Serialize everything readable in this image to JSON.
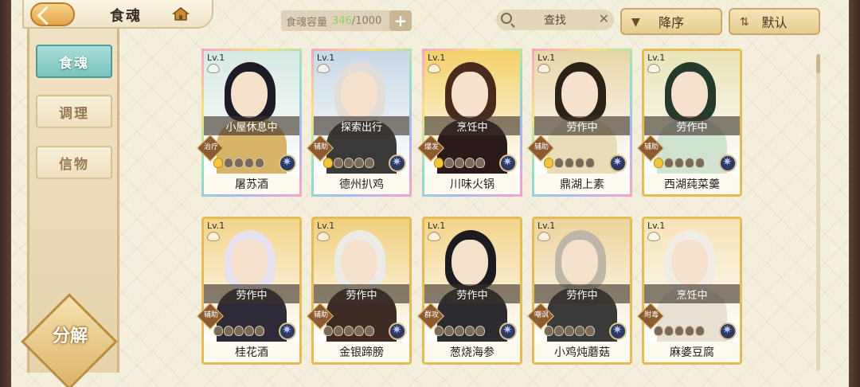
{
  "header": {
    "title": "食魂",
    "capacity_label": "食魂容量",
    "capacity_current": "346",
    "capacity_max": "/1000",
    "capacity_add": "+",
    "search_placeholder": "查找",
    "sort_order": "降序",
    "sort_mode": "默认"
  },
  "sidebar": {
    "tabs": [
      {
        "label": "食魂",
        "active": true
      },
      {
        "label": "调理",
        "active": false
      },
      {
        "label": "信物",
        "active": false
      }
    ],
    "decompose": "分解"
  },
  "cards": [
    {
      "level": "Lv.1",
      "status": "小屋休息中",
      "role": "治疗",
      "name": "屠苏酒",
      "frame": "rainbow",
      "bg": "#d7e9e4",
      "hair": "#1f1b26",
      "body": "#d8b46a",
      "stars": 1
    },
    {
      "level": "Lv.1",
      "status": "探索出行",
      "role": "辅助",
      "name": "德州扒鸡",
      "frame": "rainbow",
      "bg": "#c8d8e6",
      "hair": "#e2ddd6",
      "body": "#3b3938",
      "stars": 1
    },
    {
      "level": "Lv.1",
      "status": "烹饪中",
      "role": "爆发",
      "name": "川味火锅",
      "frame": "rainbow",
      "bg": "#f3d16a",
      "hair": "#4a2a1c",
      "body": "#2a1a1a",
      "stars": 1
    },
    {
      "level": "Lv.1",
      "status": "劳作中",
      "role": "辅助",
      "name": "鼎湖上素",
      "frame": "rainbow",
      "bg": "#e8d6a8",
      "hair": "#2b2218",
      "body": "#e9dcb8",
      "stars": 1
    },
    {
      "level": "Lv.1",
      "status": "劳作中",
      "role": "辅助",
      "name": "西湖莼菜羹",
      "frame": "gold",
      "bg": "#e9e3b7",
      "hair": "#243a2a",
      "body": "#cfe3d0",
      "stars": 1
    },
    {
      "level": "Lv.1",
      "status": "劳作中",
      "role": "辅助",
      "name": "桂花酒",
      "frame": "gold",
      "bg": "#f2d58a",
      "hair": "#e7e1f0",
      "body": "#2e2a38",
      "stars": 0
    },
    {
      "level": "Lv.1",
      "status": "劳作中",
      "role": "辅助",
      "name": "金银蹄膀",
      "frame": "gold",
      "bg": "#f0ce7c",
      "hair": "#ecebe6",
      "body": "#3e2b26",
      "stars": 0
    },
    {
      "level": "Lv.1",
      "status": "劳作中",
      "role": "群攻",
      "name": "葱烧海参",
      "frame": "gold",
      "bg": "#f3d48a",
      "hair": "#1c1c20",
      "body": "#2b2b30",
      "stars": 0
    },
    {
      "level": "Lv.1",
      "status": "劳作中",
      "role": "嘲讽",
      "name": "小鸡炖蘑菇",
      "frame": "gold",
      "bg": "#ecd49a",
      "hair": "#bdb7a8",
      "body": "#3a3a3a",
      "stars": 0
    },
    {
      "level": "Lv.1",
      "status": "烹饪中",
      "role": "附毒",
      "name": "麻婆豆腐",
      "frame": "gold",
      "bg": "#f6e3b6",
      "hair": "#f1ece4",
      "body": "#e8e0d2",
      "stars": 0
    }
  ],
  "colors": {
    "accent_teal": "#7bc3bf",
    "gold_frame": "#e3bc58",
    "capacity_green": "#8fcf6a"
  }
}
